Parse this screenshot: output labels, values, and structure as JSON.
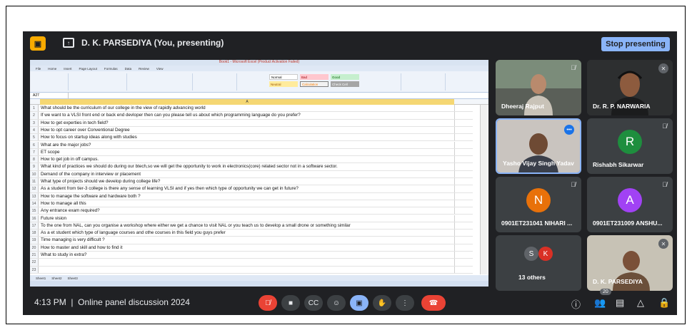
{
  "meet": {
    "presenting_text": "D. K. PARSEDIYA (You, presenting)",
    "stop_label": "Stop presenting",
    "clock": "4:13 PM",
    "separator": "|",
    "meeting_title": "Online panel discussion 2024",
    "participant_count": "20",
    "others_label": "13 others"
  },
  "excel": {
    "window_title": "Book1 - Microsoft Excel (Product Activation Failed)",
    "tabs": [
      "File",
      "Home",
      "Insert",
      "Page Layout",
      "Formulas",
      "Data",
      "Review",
      "View"
    ],
    "styles": [
      "Normal",
      "Bad",
      "Good",
      "Neutral",
      "Calculation",
      "Check Cell"
    ],
    "name_box": "A27",
    "column_header": "A",
    "sheets": [
      "Sheet1",
      "Sheet2",
      "Sheet3"
    ],
    "rows": [
      {
        "n": "1",
        "text": "What should be the curriculum of our college in the view of rapidly advancing world"
      },
      {
        "n": "2",
        "text": "If we want to a VLSI front end or back end devloper then can you please tell us about which programming language do you prefer?"
      },
      {
        "n": "3",
        "text": "How to get experties in tech field?"
      },
      {
        "n": "4",
        "text": "How to opt career over Conventional Degree"
      },
      {
        "n": "5",
        "text": "How to focus on startup ideas along with studies"
      },
      {
        "n": "6",
        "text": "What are the major jobs?"
      },
      {
        "n": "7",
        "text": "ET scope"
      },
      {
        "n": "8",
        "text": "How to get job in off campus."
      },
      {
        "n": "9",
        "text": "What kind of practices we should do during our btech,so we will get the opportunity to work in electronics(core) related sector not in a software sector."
      },
      {
        "n": "10",
        "text": "Demand of the company in interview or placement"
      },
      {
        "n": "11",
        "text": "What type of projects should we develop during college life?"
      },
      {
        "n": "12",
        "text": "As a student from tier-3 college is there any sense of learning VLSI and if yes then which type of opportunity we can get in future?"
      },
      {
        "n": "13",
        "text": "How to manage the software and hardware both ?"
      },
      {
        "n": "14",
        "text": "How to manage all this"
      },
      {
        "n": "15",
        "text": "Any entrance exam required?"
      },
      {
        "n": "16",
        "text": "Future vision"
      },
      {
        "n": "17",
        "text": "To the one from NAL, can you organise a workshop where either we get a chance to visit NAL or you teach us to develop a small drone or something similar"
      },
      {
        "n": "18",
        "text": "As a et student which type of language courses and othe courses in this field you guys prefer"
      },
      {
        "n": "19",
        "text": "Time managing is very difficult ?"
      },
      {
        "n": "20",
        "text": "How to master and skill and how to find it"
      },
      {
        "n": "21",
        "text": "What to study in extra?"
      },
      {
        "n": "22",
        "text": ""
      },
      {
        "n": "23",
        "text": ""
      }
    ]
  },
  "participants": [
    {
      "name": "Dheeraj Rajput",
      "muted": true
    },
    {
      "name": "Dr. R. P. NARWARIA",
      "muted": true
    },
    {
      "name": "Yasho Vijay Singh Yadav",
      "speaking": true
    },
    {
      "name": "Rishabh Sikarwar",
      "initial": "R",
      "color": "#1e8e3e",
      "muted": true
    },
    {
      "name": "0901ET231041 NIHARI ...",
      "initial": "N",
      "color": "#e8710a",
      "muted": true
    },
    {
      "name": "0901ET231009 ANSHU...",
      "initial": "A",
      "color": "#a142f4",
      "muted": true
    },
    {
      "name": "13 others",
      "initials": [
        "S",
        "K"
      ],
      "colors": [
        "#5f6368",
        "#d93025"
      ]
    },
    {
      "name": "D. K. PARSEDIYA",
      "muted": true
    }
  ],
  "icons": {
    "mic_off": "mic-off-icon",
    "camera": "camera-icon",
    "captions": "captions-icon",
    "emoji": "emoji-icon",
    "present": "present-icon",
    "hand": "raise-hand-icon",
    "more": "more-options-icon",
    "end": "end-call-icon",
    "info": "info-icon",
    "people": "people-icon",
    "chat": "chat-icon",
    "activities": "activities-icon",
    "lock": "host-controls-icon"
  },
  "colors": {
    "meet_bg": "#202124",
    "tile_bg": "#3c4043",
    "accent": "#8ab4f8",
    "red": "#ea4335"
  }
}
